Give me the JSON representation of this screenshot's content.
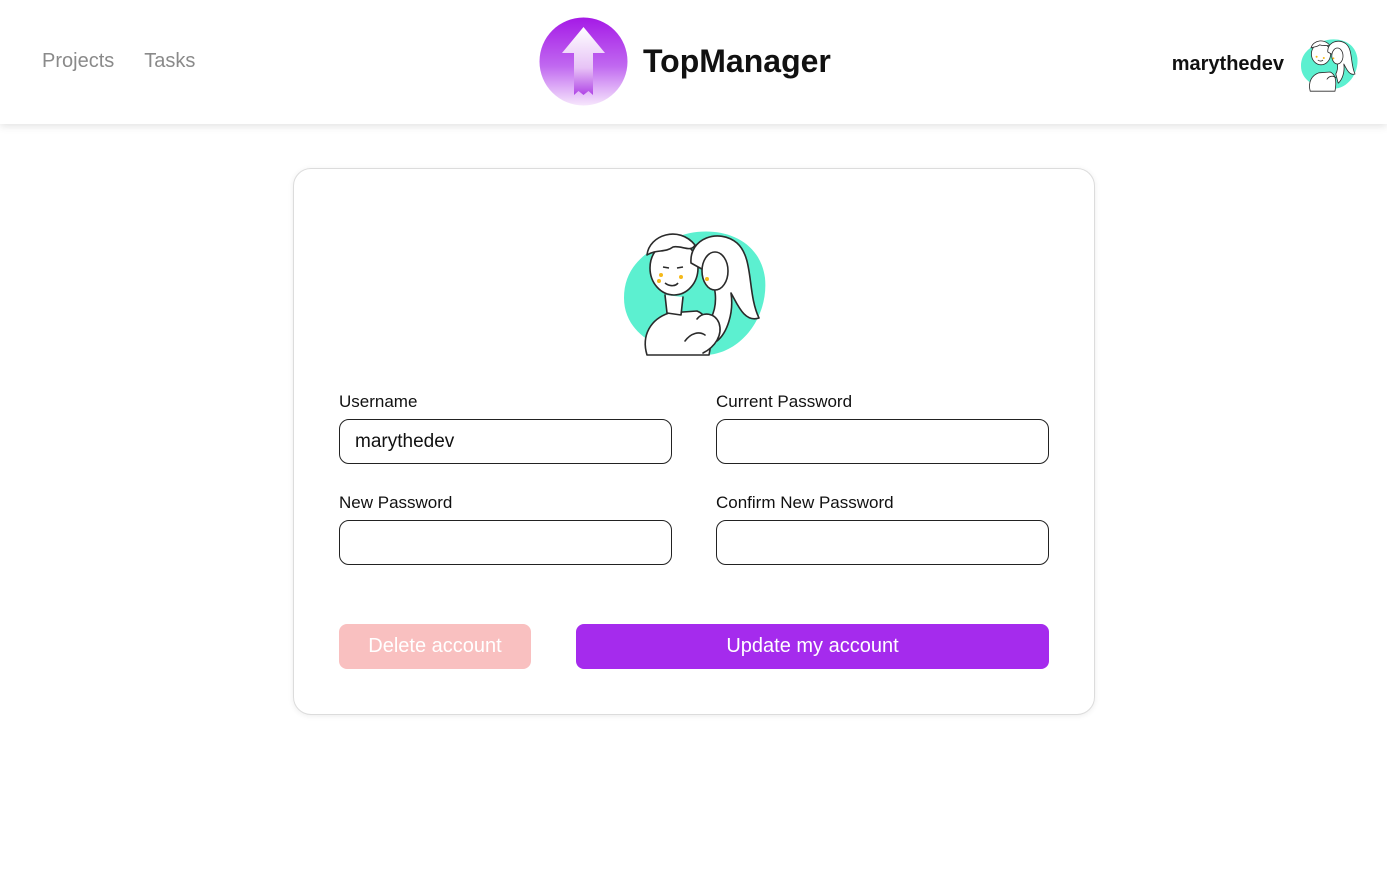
{
  "nav": {
    "projects": "Projects",
    "tasks": "Tasks"
  },
  "brand": {
    "name": "TopManager",
    "icon": "arrow-up-logo-icon"
  },
  "user": {
    "name": "marythedev",
    "avatar": "couple-illustration-avatar"
  },
  "form": {
    "username": {
      "label": "Username",
      "value": "marythedev",
      "placeholder": ""
    },
    "current_password": {
      "label": "Current Password",
      "value": "",
      "placeholder": ""
    },
    "new_password": {
      "label": "New Password",
      "value": "",
      "placeholder": ""
    },
    "confirm_password": {
      "label": "Confirm New Password",
      "value": "",
      "placeholder": ""
    }
  },
  "buttons": {
    "delete": "Delete account",
    "update": "Update my account"
  },
  "colors": {
    "accent": "#a52bed",
    "danger_light": "#f9c0c0",
    "avatar_blob": "#5cf0d0"
  }
}
